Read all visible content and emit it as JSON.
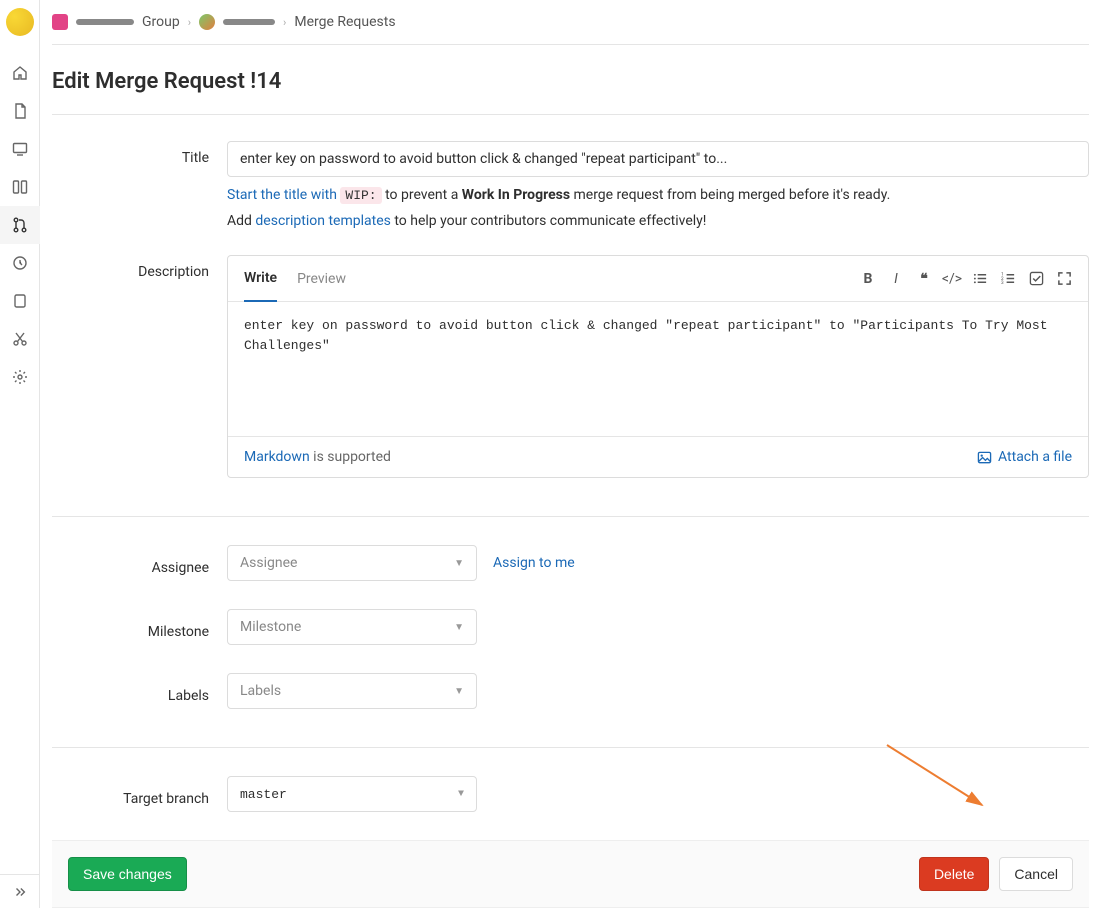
{
  "breadcrumb": {
    "group_label": "Group",
    "current": "Merge Requests"
  },
  "page": {
    "title": "Edit Merge Request !14"
  },
  "title_field": {
    "label": "Title",
    "value": "enter key on password to avoid button click & changed \"repeat participant\" to...",
    "help1_prefix": "Start the title with ",
    "help1_code": "WIP:",
    "help1_mid": " to prevent a ",
    "help1_bold": "Work In Progress",
    "help1_suffix": " merge request from being merged before it's ready.",
    "help2_prefix": "Add ",
    "help2_link": "description templates",
    "help2_suffix": " to help your contributors communicate effectively!"
  },
  "description": {
    "label": "Description",
    "tab_write": "Write",
    "tab_preview": "Preview",
    "value": "enter key on password to avoid button click & changed \"repeat participant\" to \"Participants To Try Most Challenges\"",
    "markdown_link": "Markdown",
    "markdown_suffix": " is supported",
    "attach": "Attach a file"
  },
  "assignee": {
    "label": "Assignee",
    "placeholder": "Assignee",
    "assign_to_me": "Assign to me"
  },
  "milestone": {
    "label": "Milestone",
    "placeholder": "Milestone"
  },
  "labels": {
    "label": "Labels",
    "placeholder": "Labels"
  },
  "target_branch": {
    "label": "Target branch",
    "value": "master"
  },
  "actions": {
    "save": "Save changes",
    "delete": "Delete",
    "cancel": "Cancel"
  }
}
